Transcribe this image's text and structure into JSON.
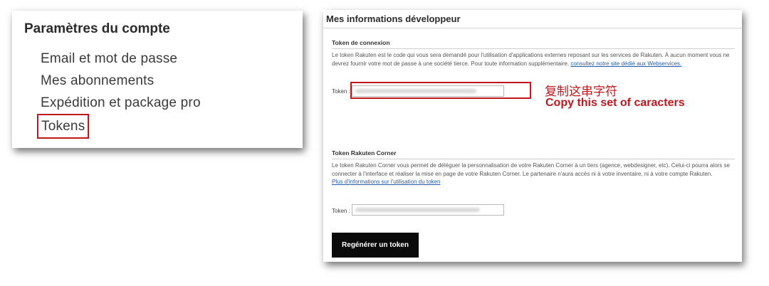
{
  "account_settings": {
    "title": "Paramètres du compte",
    "items": [
      {
        "label": "Email et mot de passe"
      },
      {
        "label": "Mes abonnements"
      },
      {
        "label": "Expédition et package pro"
      },
      {
        "label": "Tokens"
      }
    ]
  },
  "developer": {
    "title": "Mes informations développeur",
    "connection_token": {
      "heading": "Token de connexion",
      "description": "Le token Rakuten est le code qui vous sera demandé pour l'utilisation d'applications externes reposant sur les services de Rakuten. À aucun moment vous ne devrez fournir votre mot de passe à une société tierce. Pour toute information supplémentaire,",
      "link_text": "consultez notre site dédié aux Webservices.",
      "token_label": "Token :"
    },
    "corner_token": {
      "heading": "Token Rakuten Corner",
      "description": "Le token Rakuten Corner vous permet de déléguer la personnalisation de votre Rakuten Corner à un tiers (agence, webdesigner, etc). Celui-ci pourra alors se connecter à l'interface et réaliser la mise en page de votre Rakuten Corner. Le partenaire n'aura accès ni à votre inventaire, ni à votre compte Rakuten.",
      "link_text": "Plus d'informations sur l'utilisation du token",
      "token_label": "Token :"
    },
    "regenerate_button": "Regénérer un token"
  },
  "annotation": {
    "chinese": "复制这串字符",
    "english": "Copy this set of caracters",
    "color": "#c0171f"
  }
}
